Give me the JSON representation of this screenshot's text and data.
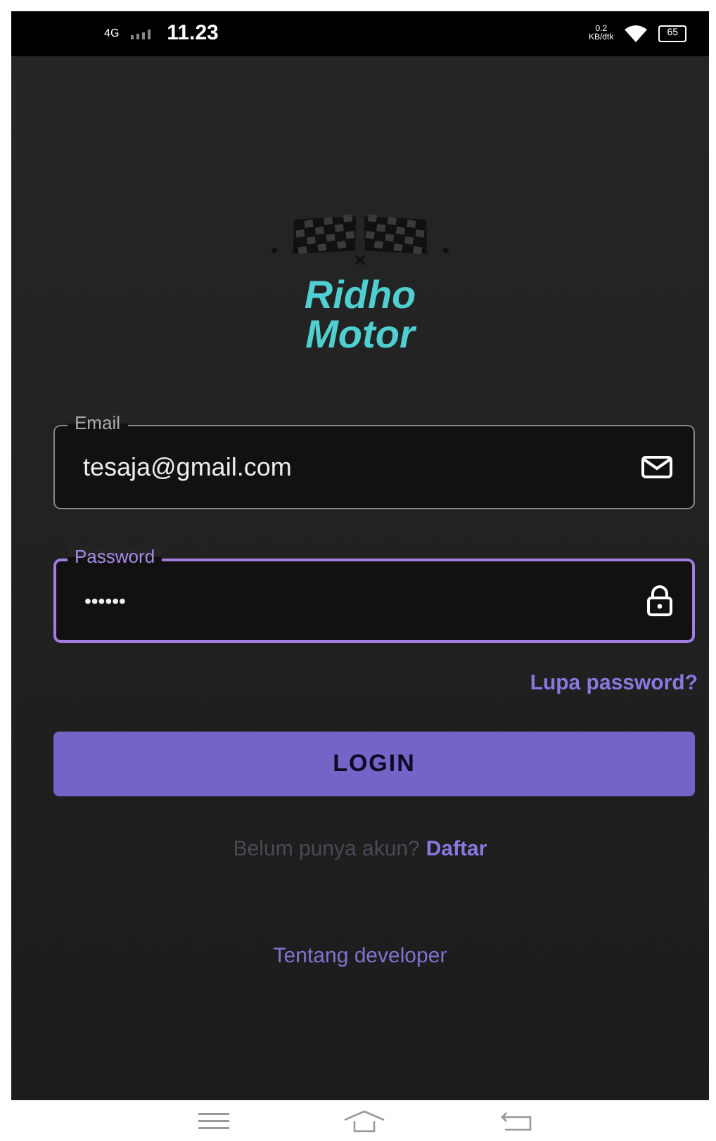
{
  "status_bar": {
    "network": "4G",
    "time": "11.23",
    "speed": "0.2",
    "speed_unit": "KB/dtk",
    "battery": "65"
  },
  "logo": {
    "line_1": "Ridho",
    "line_2": "Motor"
  },
  "fields": [
    {
      "kind": "email",
      "label": "Email",
      "value": "tesaja@gmail.com",
      "focused": false
    },
    {
      "kind": "password",
      "label": "Password",
      "value": "••••••",
      "focused": true
    }
  ],
  "forgot_link": "Lupa password?",
  "login_button": "LOGIN",
  "register": {
    "prompt": "Belum punya akun?",
    "link": "Daftar"
  },
  "about_link": "Tentang developer"
}
